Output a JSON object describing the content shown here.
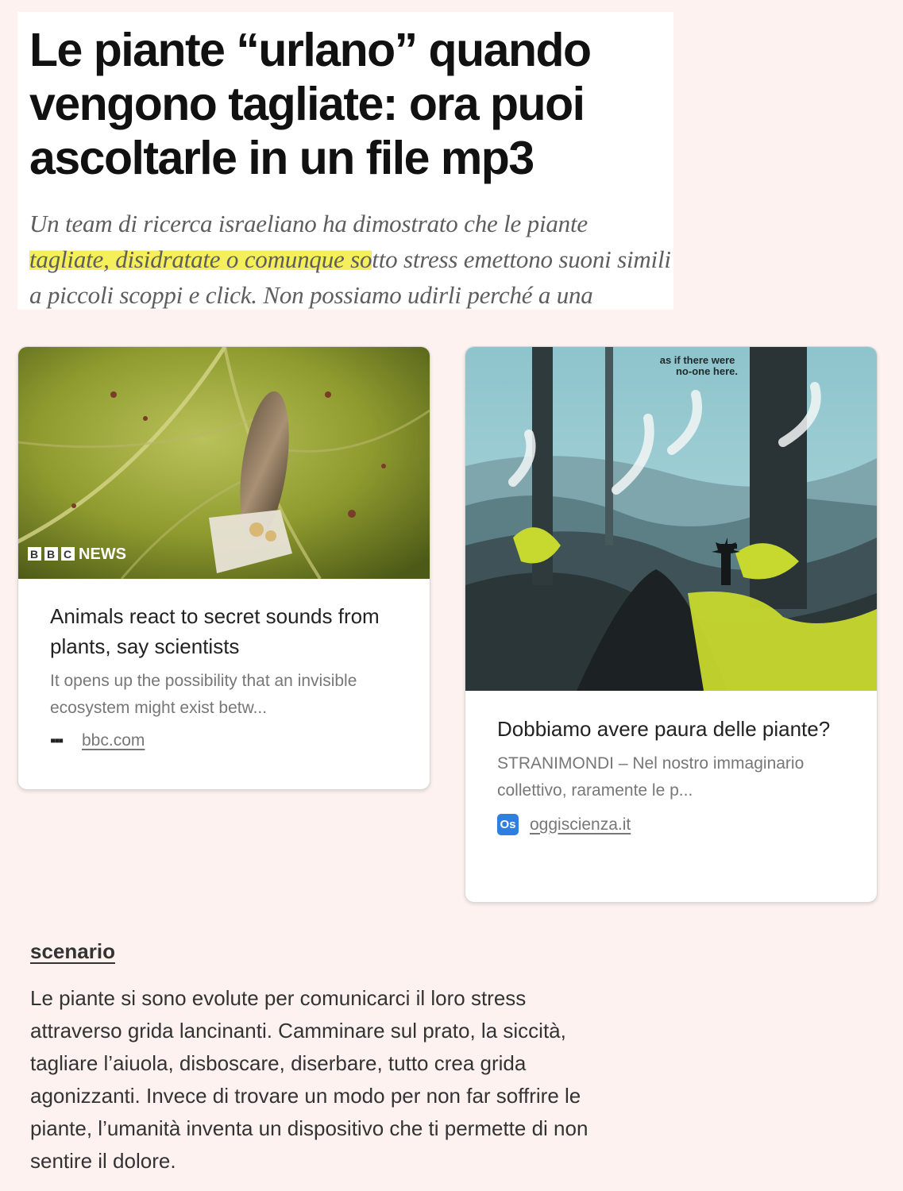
{
  "headline": "Le piante “urlano” quando vengono tagliate: ora puoi ascoltarle in un file mp3",
  "excerpt": {
    "before": "Un team di ricerca israeliano ha dimostrato che le piante ",
    "highlighted": "tagliate, disidratate o comunque so",
    "after": "tto stress emettono suoni simili a piccoli scoppi e click. Non possiamo udirli perché a una",
    "highlight_color": "#f6ef5c"
  },
  "cards": [
    {
      "image_label": "BBC NEWS",
      "title": "Animals react to secret sounds from plants, say scientists",
      "description": "It opens up the possibility that an invisible ecosystem might exist betw...",
      "source": "bbc.com",
      "favicon": "bbc-dots-icon"
    },
    {
      "image_caption": "as if there were no-one here.",
      "title": "Dobbiamo avere paura delle piante?",
      "description": "STRANIMONDI – Nel nostro immaginario collettivo, raramente le p...",
      "source": "oggiscienza.it",
      "favicon": "oggiscienza-icon",
      "favicon_text": "Os",
      "favicon_color": "#2f7ee0"
    }
  ],
  "scenario": {
    "heading": "scenario",
    "text": "Le piante si sono evolute per comunicarci il loro stress attraverso grida lancinanti. Camminare sul prato, la siccità, tagliare l’aiuola, disboscare, diserbare, tutto crea grida agonizzanti. Invece di trovare un modo per non far soffrire le piante, l’umanità inventa un dispositivo che ti permette di non sentire il dolore."
  },
  "colors": {
    "page_background": "#fdf2f0"
  }
}
